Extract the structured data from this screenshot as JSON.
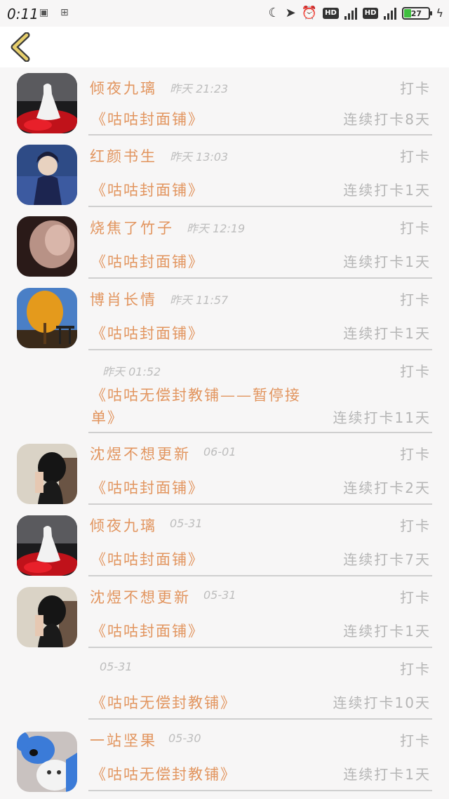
{
  "status_bar": {
    "time": "0:11",
    "hd1": "HD",
    "hd2": "HD",
    "battery": "27"
  },
  "nav": {
    "back_icon": "chevron-left-icon",
    "accent": "#e0c060"
  },
  "items": [
    {
      "name": "倾夜九璃",
      "time": "昨天 21:23",
      "checkin": "打卡",
      "shop": "《咕咕封面铺》",
      "streak": "连续打卡8天"
    },
    {
      "name": "红颜书生",
      "time": "昨天 13:03",
      "checkin": "打卡",
      "shop": "《咕咕封面铺》",
      "streak": "连续打卡1天"
    },
    {
      "name": "烧焦了竹子",
      "time": "昨天 12:19",
      "checkin": "打卡",
      "shop": "《咕咕封面铺》",
      "streak": "连续打卡1天"
    },
    {
      "name": "博肖长情",
      "time": "昨天 11:57",
      "checkin": "打卡",
      "shop": "《咕咕封面铺》",
      "streak": "连续打卡1天"
    },
    {
      "name": "",
      "time": "昨天 01:52",
      "checkin": "打卡",
      "shop_line1": "《咕咕无偿封教铺——暂停接",
      "shop_line2": "单》",
      "streak": "连续打卡11天"
    },
    {
      "name": "沈煜不想更新",
      "time": "06-01",
      "checkin": "打卡",
      "shop": "《咕咕封面铺》",
      "streak": "连续打卡2天"
    },
    {
      "name": "倾夜九璃",
      "time": "05-31",
      "checkin": "打卡",
      "shop": "《咕咕封面铺》",
      "streak": "连续打卡7天"
    },
    {
      "name": "沈煜不想更新",
      "time": "05-31",
      "checkin": "打卡",
      "shop": "《咕咕封面铺》",
      "streak": "连续打卡1天"
    },
    {
      "name": "",
      "time": "05-31",
      "checkin": "打卡",
      "shop": "《咕咕无偿封教铺》",
      "streak": "连续打卡10天"
    },
    {
      "name": "一站坚果",
      "time": "05-30",
      "checkin": "打卡",
      "shop": "《咕咕无偿封教铺》",
      "streak": "连续打卡1天"
    }
  ]
}
